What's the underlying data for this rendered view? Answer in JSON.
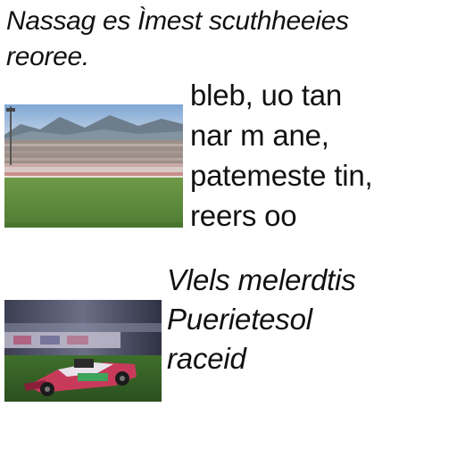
{
  "headline": {
    "line1": "Nassag es Ìmest  scuthheeies",
    "line2": "reoree."
  },
  "story1": {
    "image_subject": "stadium-track-photo",
    "lines": [
      "bleb, uo tan",
      "nar  m ane,",
      "patemeste tin,",
      "reers  oo"
    ]
  },
  "story2": {
    "image_subject": "race-car-photo",
    "lines": [
      "Vlels  melerdtis",
      "Puerietesol",
      "raceid"
    ]
  },
  "colors": {
    "background": "#ffffff",
    "text": "#111111",
    "sky": "#9fb8d8",
    "grass": "#5d8a3e",
    "car_body": "#c83a5a"
  }
}
